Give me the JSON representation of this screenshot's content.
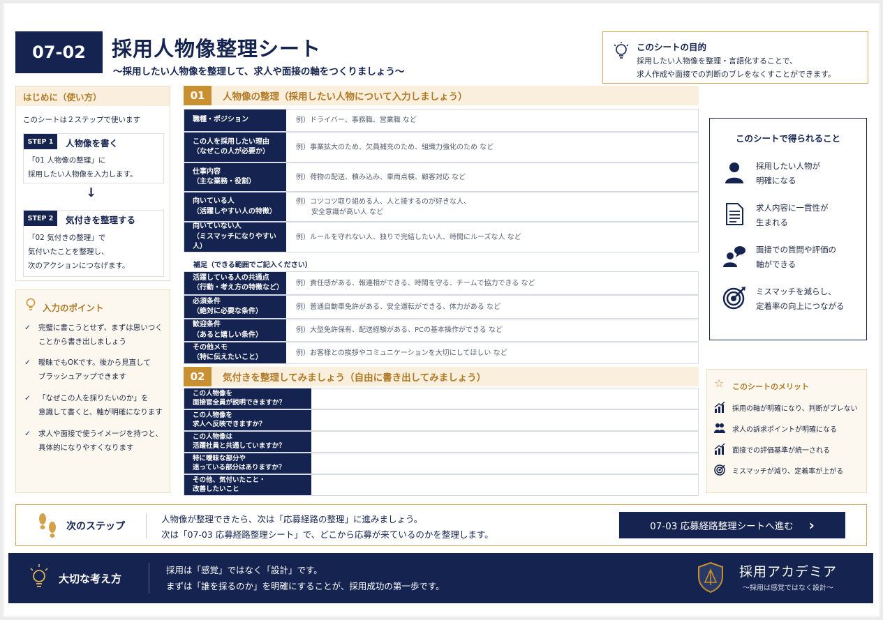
{
  "header": {
    "badge": "07-02",
    "title": "採用人物像整理シート",
    "subtitle": "〜採用したい人物像を整理して、求人や面接の軸をつくりましょう〜"
  },
  "purpose": {
    "title": "このシートの目的",
    "line1": "採用したい人物像を整理・言語化することで、",
    "line2": "求人作成や面接での判断のブレをなくすことができます。"
  },
  "howto": {
    "title": "はじめに（使い方）",
    "intro": "このシートは２ステップで使います",
    "step1": {
      "tag": "STEP 1",
      "title": "人物像を書く",
      "line1": "「01 人物像の整理」に",
      "line2": "採用したい人物像を入力します。"
    },
    "arrow": "↓",
    "step2": {
      "tag": "STEP 2",
      "title": "気付きを整理する",
      "line1": "「02 気付きの整理」で",
      "line2": "気付いたことを整理し、",
      "line3": "次のアクションにつなげます。"
    }
  },
  "points": {
    "title": "入力のポイント",
    "items": [
      {
        "l1": "完璧に書こうとせず、まずは思いつく",
        "l2": "ことから書き出しましょう"
      },
      {
        "l1": "曖昧でもOKです。後から見直して",
        "l2": "ブラッシュアップできます"
      },
      {
        "l1": "「なぜこの人を採りたいのか」を",
        "l2": "意識して書くと、軸が明確になります"
      },
      {
        "l1": "求人や面接で使うイメージを持つと、",
        "l2": "具体的になりやすくなります"
      }
    ]
  },
  "section1": {
    "num": "01",
    "title": "人物像の整理（採用したい人物について入力しましょう）",
    "rows": [
      {
        "h1": "職種・ポジション",
        "h2": "",
        "v1": "例）ドライバー、事務職、営業職 など",
        "v2": ""
      },
      {
        "h1": "この人を採用したい理由",
        "h2": "（なぜこの人が必要か）",
        "v1": "例）事業拡大のため、欠員補充のため、組織力強化のため など",
        "v2": ""
      },
      {
        "h1": "仕事内容",
        "h2": "（主な業務・役割）",
        "v1": "例）荷物の配送、積み込み、車両点検、顧客対応 など",
        "v2": ""
      },
      {
        "h1": "向いている人",
        "h2": "（活躍しやすい人の特徴）",
        "v1": "例）コツコツ取り組める人、人と接するのが好きな人、",
        "v2": "安全意識が高い人 など"
      },
      {
        "h1": "向いていない人",
        "h2": "（ミスマッチになりやすい人）",
        "v1": "例）ルールを守れない人、独りで完結したい人、時間にルーズな人 など",
        "v2": ""
      }
    ],
    "supplement_label": "補足（できる範囲でご記入ください）",
    "supp_rows": [
      {
        "h1": "活躍している人の共通点",
        "h2": "（行動・考え方の特徴など）",
        "v1": "例）責任感がある、報連相ができる、時間を守る、チームで協力できる など"
      },
      {
        "h1": "必須条件",
        "h2": "（絶対に必要な条件）",
        "v1": "例）普通自動車免許がある、安全運転ができる、体力がある など"
      },
      {
        "h1": "歓迎条件",
        "h2": "（あると嬉しい条件）",
        "v1": "例）大型免許保有、配送経験がある、PCの基本操作ができる など"
      },
      {
        "h1": "その他メモ",
        "h2": "（特に伝えたいこと）",
        "v1": "例）お客様との挨拶やコミュニケーションを大切にしてほしい など"
      }
    ]
  },
  "section2": {
    "num": "02",
    "title": "気付きを整理してみましょう（自由に書き出してみましょう）",
    "rows": [
      {
        "h1": "この人物像を",
        "h2": "面接官全員が説明できますか？"
      },
      {
        "h1": "この人物像を",
        "h2": "求人へ反映できますか？"
      },
      {
        "h1": "この人物像は",
        "h2": "活躍社員と共通していますか？"
      },
      {
        "h1": "特に曖昧な部分や",
        "h2": "迷っている部分はありますか？"
      },
      {
        "h1": "その他、気付いたこと・",
        "h2": "改善したいこと"
      }
    ]
  },
  "benefits": {
    "title": "このシートで得られること",
    "items": [
      {
        "icon": "person-icon",
        "l1": "採用したい人物が",
        "l2": "明確になる"
      },
      {
        "icon": "document-icon",
        "l1": "求人内容に一貫性が",
        "l2": "生まれる"
      },
      {
        "icon": "people-chat-icon",
        "l1": "面接での質問や評価の",
        "l2": "軸ができる"
      },
      {
        "icon": "target-icon",
        "l1": "ミスマッチを減らし、",
        "l2": "定着率の向上につながる"
      }
    ]
  },
  "merits": {
    "title": "このシートのメリット",
    "items": [
      {
        "icon": "bar-chart-icon",
        "text": "採用の軸が明確になり、判断がブレない"
      },
      {
        "icon": "handshake-icon",
        "text": "求人の訴求ポイントが明確になる"
      },
      {
        "icon": "bar-chart-icon",
        "text": "面接での評価基準が統一される"
      },
      {
        "icon": "target-icon",
        "text": "ミスマッチが減り、定着率が上がる"
      }
    ]
  },
  "next": {
    "label": "次のステップ",
    "line1": "人物像が整理できたら、次は「応募経路の整理」に進みましょう。",
    "line2": "次は「07-03 応募経路整理シート」で、どこから応募が来ているのかを整理します。",
    "button": "07-03 応募経路整理シートへ進む",
    "button_icon": "›"
  },
  "footer": {
    "label": "大切な考え方",
    "line1": "採用は「感覚」ではなく「設計」です。",
    "line2": "まずは「誰を採るのか」を明確にすることが、採用成功の第一歩です。",
    "brand": "採用アカデミア",
    "tagline": "〜採用は感覚ではなく設計〜"
  },
  "colors": {
    "navy": "#14234f",
    "gold": "#c99032",
    "cream": "#faeedd"
  }
}
